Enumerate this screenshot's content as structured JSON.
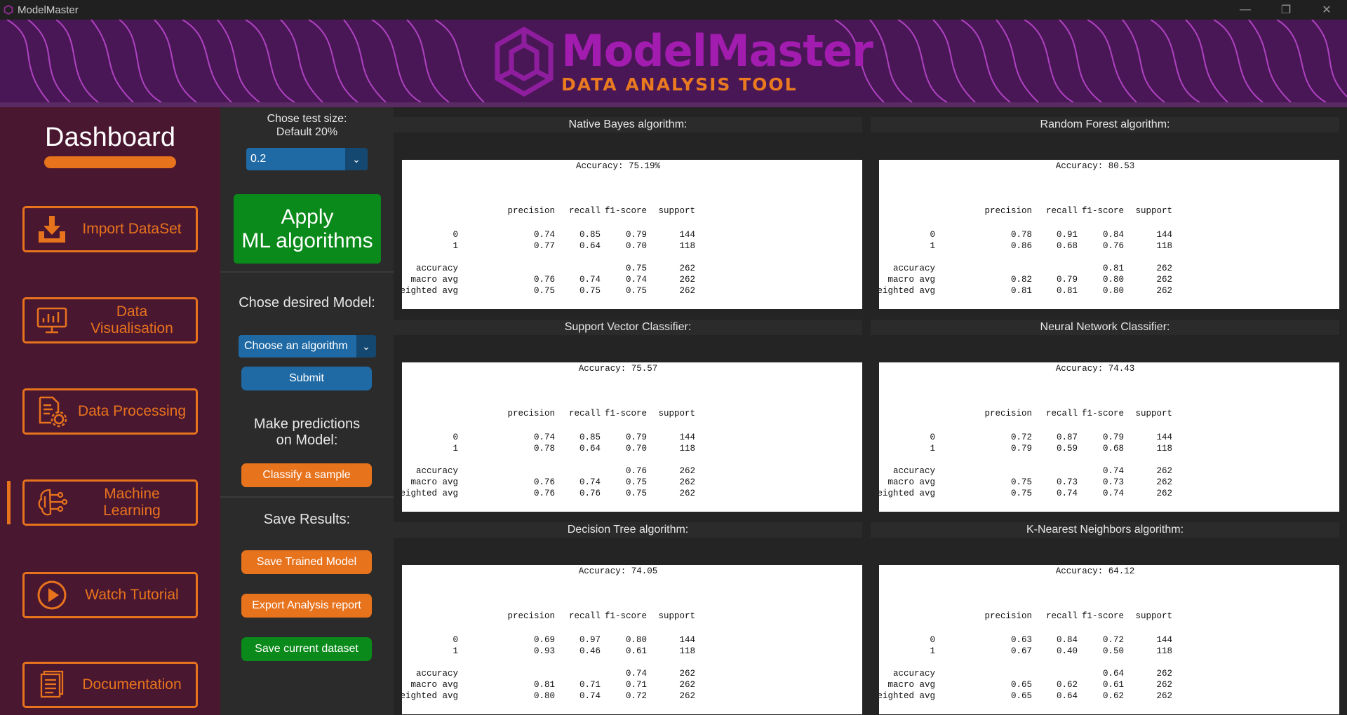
{
  "window": {
    "title": "ModelMaster",
    "minimize": "—",
    "maximize": "❐",
    "close": "✕"
  },
  "banner": {
    "title": "ModelMaster",
    "subtitle": "DATA ANALYSIS TOOL"
  },
  "sidebar": {
    "title": "Dashboard",
    "items": [
      {
        "label": "Import DataSet",
        "icon": "download-icon"
      },
      {
        "label": "Data Visualisation",
        "icon": "chart-monitor-icon"
      },
      {
        "label": "Data Processing",
        "icon": "document-gear-icon"
      },
      {
        "label": "Machine Learning",
        "icon": "brain-circuit-icon",
        "active": true
      },
      {
        "label": "Watch Tutorial",
        "icon": "play-icon"
      },
      {
        "label": "Documentation",
        "icon": "documents-icon"
      }
    ]
  },
  "controls": {
    "test_size_label_1": "Chose test size:",
    "test_size_label_2": "Default 20%",
    "test_size_value": "0.2",
    "apply_label_1": "Apply",
    "apply_label_2": "ML algorithms",
    "model_label": "Chose desired Model:",
    "model_select_value": "Choose an algorithm",
    "submit_label": "Submit",
    "predict_label_1": "Make predictions",
    "predict_label_2": "on Model:",
    "classify_label": "Classify a sample",
    "save_label": "Save Results:",
    "save_model_label": "Save Trained Model",
    "export_label": "Export Analysis report",
    "save_dataset_label": "Save current dataset"
  },
  "report_headers": [
    "precision",
    "recall",
    "f1-score",
    "support"
  ],
  "report_rows": [
    "0",
    "1",
    "accuracy",
    "macro avg",
    "weighted avg"
  ],
  "panels": [
    {
      "title": "Native Bayes algorithm:",
      "accuracy": "Accuracy: 75.19%",
      "r0": [
        "0.74",
        "0.85",
        "0.79",
        "144"
      ],
      "r1": [
        "0.77",
        "0.64",
        "0.70",
        "118"
      ],
      "acc": [
        "",
        "",
        "0.75",
        "262"
      ],
      "macro": [
        "0.76",
        "0.74",
        "0.74",
        "262"
      ],
      "weighted": [
        "0.75",
        "0.75",
        "0.75",
        "262"
      ]
    },
    {
      "title": "Random Forest algorithm:",
      "accuracy": "Accuracy: 80.53",
      "r0": [
        "0.78",
        "0.91",
        "0.84",
        "144"
      ],
      "r1": [
        "0.86",
        "0.68",
        "0.76",
        "118"
      ],
      "acc": [
        "",
        "",
        "0.81",
        "262"
      ],
      "macro": [
        "0.82",
        "0.79",
        "0.80",
        "262"
      ],
      "weighted": [
        "0.81",
        "0.81",
        "0.80",
        "262"
      ]
    },
    {
      "title": "Support Vector Classifier:",
      "accuracy": "Accuracy: 75.57",
      "r0": [
        "0.74",
        "0.85",
        "0.79",
        "144"
      ],
      "r1": [
        "0.78",
        "0.64",
        "0.70",
        "118"
      ],
      "acc": [
        "",
        "",
        "0.76",
        "262"
      ],
      "macro": [
        "0.76",
        "0.74",
        "0.75",
        "262"
      ],
      "weighted": [
        "0.76",
        "0.76",
        "0.75",
        "262"
      ]
    },
    {
      "title": "Neural Network Classifier:",
      "accuracy": "Accuracy: 74.43",
      "r0": [
        "0.72",
        "0.87",
        "0.79",
        "144"
      ],
      "r1": [
        "0.79",
        "0.59",
        "0.68",
        "118"
      ],
      "acc": [
        "",
        "",
        "0.74",
        "262"
      ],
      "macro": [
        "0.75",
        "0.73",
        "0.73",
        "262"
      ],
      "weighted": [
        "0.75",
        "0.74",
        "0.74",
        "262"
      ]
    },
    {
      "title": "Decision Tree algorithm:",
      "accuracy": "Accuracy: 74.05",
      "r0": [
        "0.69",
        "0.97",
        "0.80",
        "144"
      ],
      "r1": [
        "0.93",
        "0.46",
        "0.61",
        "118"
      ],
      "acc": [
        "",
        "",
        "0.74",
        "262"
      ],
      "macro": [
        "0.81",
        "0.71",
        "0.71",
        "262"
      ],
      "weighted": [
        "0.80",
        "0.74",
        "0.72",
        "262"
      ]
    },
    {
      "title": "K-Nearest Neighbors algorithm:",
      "accuracy": "Accuracy: 64.12",
      "r0": [
        "0.63",
        "0.84",
        "0.72",
        "144"
      ],
      "r1": [
        "0.67",
        "0.40",
        "0.50",
        "118"
      ],
      "acc": [
        "",
        "",
        "0.64",
        "262"
      ],
      "macro": [
        "0.65",
        "0.62",
        "0.61",
        "262"
      ],
      "weighted": [
        "0.65",
        "0.64",
        "0.62",
        "262"
      ]
    }
  ],
  "colors": {
    "accent": "#e8731d",
    "sidebar_bg": "#4a1730",
    "banner_bg": "#4a1756",
    "apply_green": "#0a8a1a",
    "dropdown_blue": "#1f6aa5"
  }
}
